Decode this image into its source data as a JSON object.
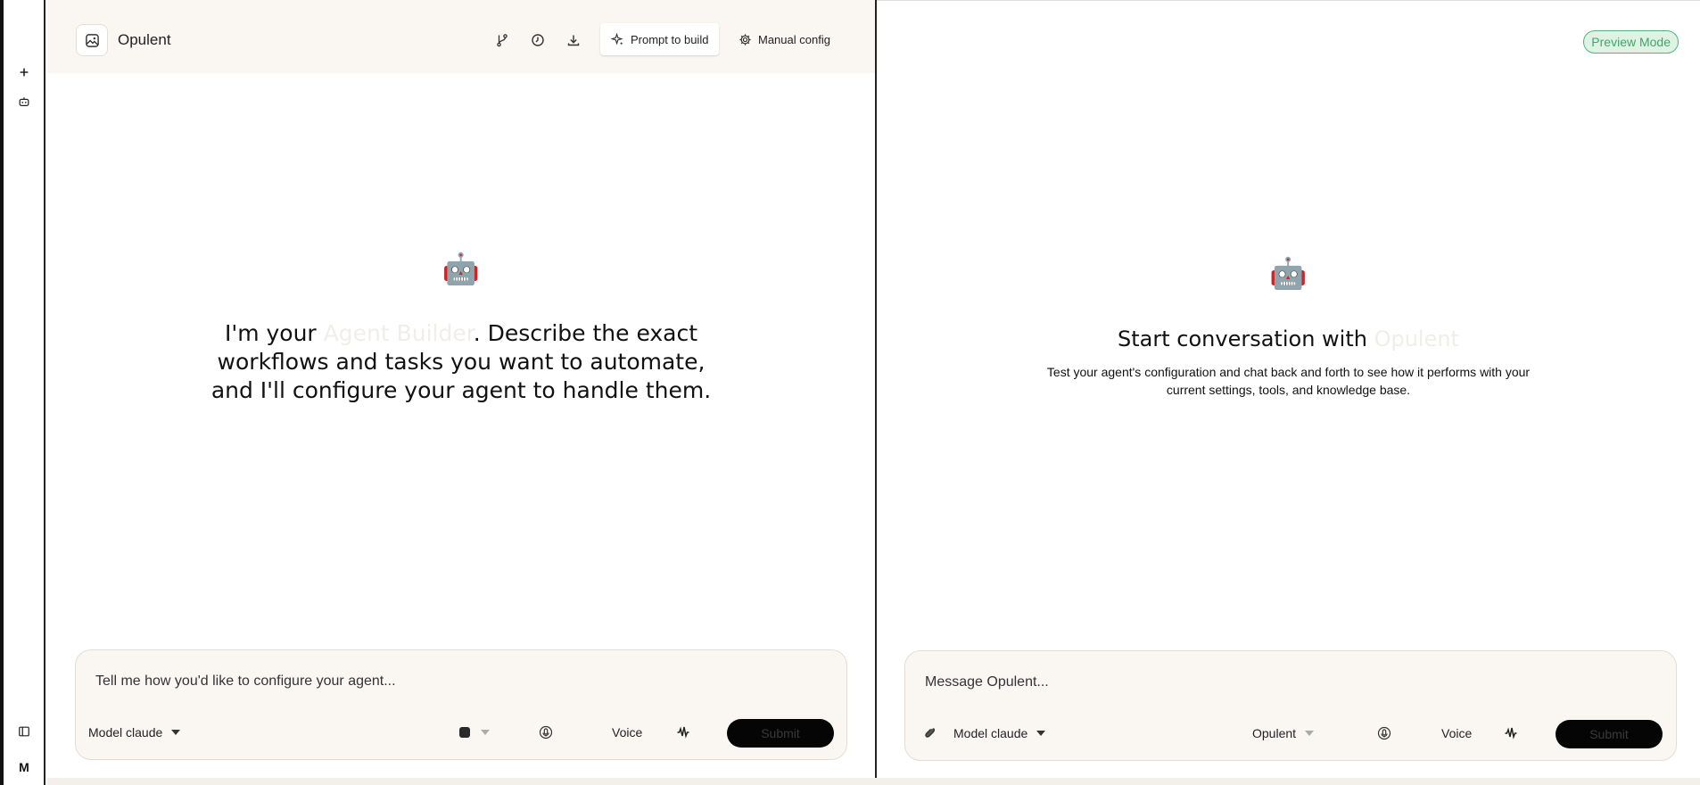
{
  "rail": {
    "new_icon": "plus-icon",
    "agents_icon": "robot-icon",
    "sidebar_icon": "sidebar-toggle-icon",
    "user_initial": "M"
  },
  "builder": {
    "agent_name": "Opulent",
    "header_icons": [
      "branch-icon",
      "history-clock-icon",
      "download-icon"
    ],
    "tabs": [
      {
        "label": "Prompt to build",
        "icon": "sparkle-icon",
        "active": true
      },
      {
        "label": "Manual config",
        "icon": "gear-icon",
        "active": false
      }
    ],
    "robot_emoji": "🤖",
    "intro_prefix": "I'm your ",
    "intro_highlight": "Agent Builder",
    "intro_line1_suffix": ". Describe the exact",
    "intro_line2": "workflows and tasks you want to automate,",
    "intro_line3": "and I'll configure your agent to handle them.",
    "composer": {
      "placeholder": "Tell me how you'd like to configure your agent...",
      "model_label": "Model claude",
      "voice_label": "Voice",
      "submit_label": "Submit"
    }
  },
  "preview": {
    "badge": "Preview Mode",
    "robot_emoji": "🤖",
    "title_prefix": "Start conversation with ",
    "title_highlight": "Opulent",
    "desc_line1": "Test your agent's configuration and chat back and forth to see how it performs with your",
    "desc_line2": "current settings, tools, and knowledge base.",
    "composer": {
      "placeholder": "Message Opulent...",
      "model_label": "Model claude",
      "agent_label": "Opulent",
      "voice_label": "Voice",
      "submit_label": "Submit"
    }
  },
  "colors": {
    "header_bg": "#faf6f1",
    "composer_bg": "#faf7f3",
    "badge_bg": "#dff3e4",
    "badge_text": "#3fa56a",
    "submit_bg": "#050505"
  }
}
